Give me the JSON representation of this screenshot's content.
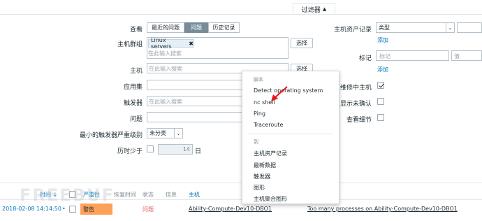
{
  "filter_tab": {
    "label": "过滤器",
    "arrow": "▲"
  },
  "form": {
    "view_label": "查看",
    "view_tabs": [
      "最近的问题",
      "问题",
      "历史记录"
    ],
    "hostgroup_label": "主机群组",
    "hostgroup_tag": "Linux servers",
    "hostgroup_placeholder": "在此输入搜索",
    "select_label": "选择",
    "host_label": "主机",
    "host_placeholder": "在此输入搜索",
    "app_label": "应用集",
    "trigger_label": "触发器",
    "trigger_placeholder": "在此输入搜索",
    "problem_label": "问题",
    "min_severity_label": "最小的触发器严重级别",
    "min_severity_value": "未分类",
    "age_label": "历时少于",
    "age_value": "14",
    "age_unit": "日",
    "inventory_label": "主机资产记录",
    "inventory_select": "类型",
    "add_label": "添加",
    "tags_label": "标记",
    "tag_placeholder": "标记",
    "value_placeholder": "值",
    "maint_label": "维修中主机",
    "unack_label": "仅显示未确认",
    "details_label": "查看细节"
  },
  "menu": {
    "scripts_header": "脚本",
    "scripts": [
      "Detect operating system",
      "nc shell",
      "Ping",
      "Traceroute"
    ],
    "goto_header": "到",
    "goto": [
      "主机资产记录",
      "最新数据",
      "触发器",
      "图形",
      "主机聚合图形"
    ]
  },
  "table": {
    "headers": [
      "时间",
      "严重性",
      "恢复时间",
      "状态",
      "信息",
      "主机"
    ],
    "row": {
      "time": "2018-02-08 14:14:50",
      "severity": "警告",
      "status": "问题",
      "host": "Ability-Compute-Dev10-DBO1",
      "problem": "Too many processes on Ability-Compute-Dev10-DBO1"
    }
  },
  "watermark": "FREEBUF",
  "colors": {
    "accent": "#0275b8",
    "warning": "#ffa059",
    "problem": "#e45959",
    "arrow": "#e8151b"
  }
}
